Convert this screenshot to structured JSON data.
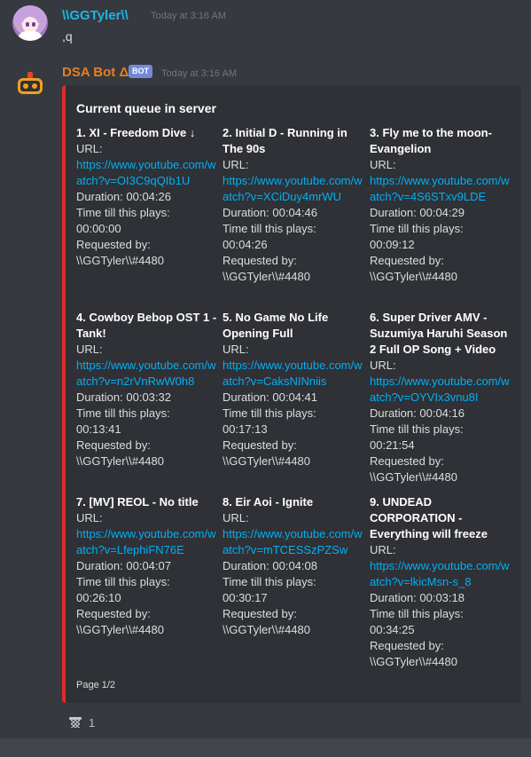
{
  "messages": [
    {
      "author": "\\\\GGTyler\\\\",
      "timestamp": "Today at 3:16 AM",
      "content": ",q"
    },
    {
      "author": "DSA Bot Δ",
      "badge": "BOT",
      "timestamp": "Today at 3:16 AM",
      "embed": {
        "title": "Current queue in server",
        "accent_color": "#e02b2b",
        "labels": {
          "url": "URL:",
          "duration": "Duration: ",
          "time_till": "Time till this plays:",
          "requested": "Requested by:"
        },
        "fields": [
          {
            "name": "1. XI - Freedom Dive ↓",
            "url": "https://www.youtube.com/watch?v=OI3C9qQIb1U",
            "duration": "00:04:26",
            "time_till": "00:00:00",
            "requested_by": "\\\\GGTyler\\\\#4480"
          },
          {
            "name": "2. Initial D - Running in The 90s",
            "url": "https://www.youtube.com/watch?v=XCiDuy4mrWU",
            "duration": "00:04:46",
            "time_till": "00:04:26",
            "requested_by": "\\\\GGTyler\\\\#4480"
          },
          {
            "name": "3. Fly me to the moon- Evangelion",
            "url": "https://www.youtube.com/watch?v=4S6STxv9LDE",
            "duration": "00:04:29",
            "time_till": "00:09:12",
            "requested_by": "\\\\GGTyler\\\\#4480"
          },
          {
            "name": "4. Cowboy Bebop OST 1 - Tank!",
            "url": "https://www.youtube.com/watch?v=n2rVnRwW0h8",
            "duration": "00:03:32",
            "time_till": "00:13:41",
            "requested_by": "\\\\GGTyler\\\\#4480"
          },
          {
            "name": "5. No Game No Life Opening Full",
            "url": "https://www.youtube.com/watch?v=CaksNINniis",
            "duration": "00:04:41",
            "time_till": "00:17:13",
            "requested_by": "\\\\GGTyler\\\\#4480"
          },
          {
            "name": "6. Super Driver AMV - Suzumiya Haruhi Season 2 Full OP Song + Video",
            "url": "https://www.youtube.com/watch?v=OYVIx3vnu8I",
            "duration": "00:04:16",
            "time_till": "00:21:54",
            "requested_by": "\\\\GGTyler\\\\#4480"
          },
          {
            "name": "7. [MV] REOL - No title",
            "url": "https://www.youtube.com/watch?v=LfephiFN76E",
            "duration": "00:04:07",
            "time_till": "00:26:10",
            "requested_by": "\\\\GGTyler\\\\#4480"
          },
          {
            "name": "8. Eir Aoi - Ignite",
            "url": "https://www.youtube.com/watch?v=mTCESSzPZSw",
            "duration": "00:04:08",
            "time_till": "00:30:17",
            "requested_by": "\\\\GGTyler\\\\#4480"
          },
          {
            "name": "9. UNDEAD CORPORATION - Everything will freeze",
            "url": "https://www.youtube.com/watch?v=lkicMsn-s_8",
            "duration": "00:03:18",
            "time_till": "00:34:25",
            "requested_by": "\\\\GGTyler\\\\#4480"
          }
        ],
        "footer": "Page 1/2"
      },
      "reactions": [
        {
          "icon": "basketball-hoop-icon",
          "count": "1"
        }
      ]
    }
  ]
}
